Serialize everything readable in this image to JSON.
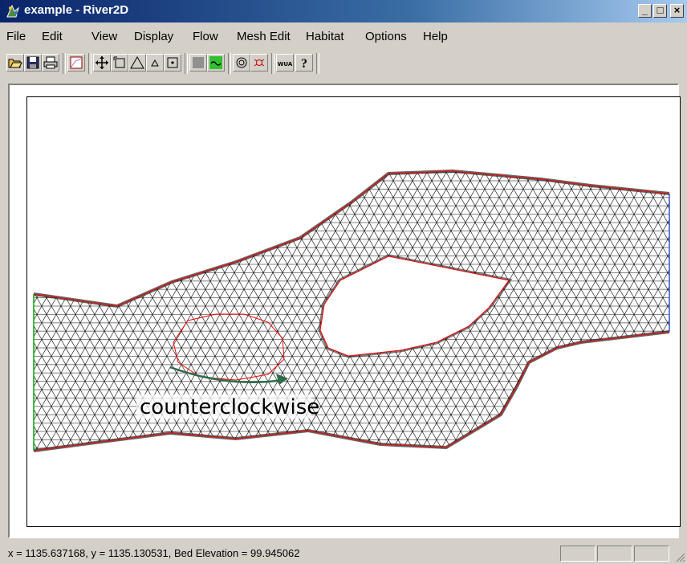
{
  "window": {
    "title": "example - River2D",
    "icon": "river2d-app-icon"
  },
  "title_buttons": [
    "minimize",
    "maximize",
    "close"
  ],
  "menu": [
    {
      "id": "file",
      "label": "File"
    },
    {
      "id": "edit",
      "label": "Edit"
    },
    {
      "id": "view",
      "label": "View"
    },
    {
      "id": "display",
      "label": "Display"
    },
    {
      "id": "flow",
      "label": "Flow"
    },
    {
      "id": "meshedit",
      "label": "Mesh Edit"
    },
    {
      "id": "habitat",
      "label": "Habitat"
    },
    {
      "id": "options",
      "label": "Options"
    },
    {
      "id": "help",
      "label": "Help"
    }
  ],
  "toolbar": {
    "buttons": [
      {
        "name": "open-icon"
      },
      {
        "name": "save-icon"
      },
      {
        "name": "print-icon"
      },
      {
        "name": "plot-icon"
      },
      {
        "name": "pan-icon"
      },
      {
        "name": "zoom-box-icon"
      },
      {
        "name": "triangle-icon"
      },
      {
        "name": "small-triangle-icon"
      },
      {
        "name": "node-icon"
      },
      {
        "name": "gray-square-icon"
      },
      {
        "name": "flow-wave-icon"
      },
      {
        "name": "target-icon"
      },
      {
        "name": "bug-icon"
      },
      {
        "name": "wua-icon",
        "label": "WUA"
      },
      {
        "name": "help-pointer-icon"
      }
    ]
  },
  "canvas": {
    "annotation": "counterclockwise",
    "colors": {
      "mesh": "#000000",
      "boundary": "#ff0000",
      "inflow": "#00aa00",
      "outflow": "#3355cc",
      "arrow": "#2e6b4a"
    }
  },
  "status": {
    "text": "x = 1135.637168, y = 1135.130531, Bed Elevation = 99.945062"
  }
}
